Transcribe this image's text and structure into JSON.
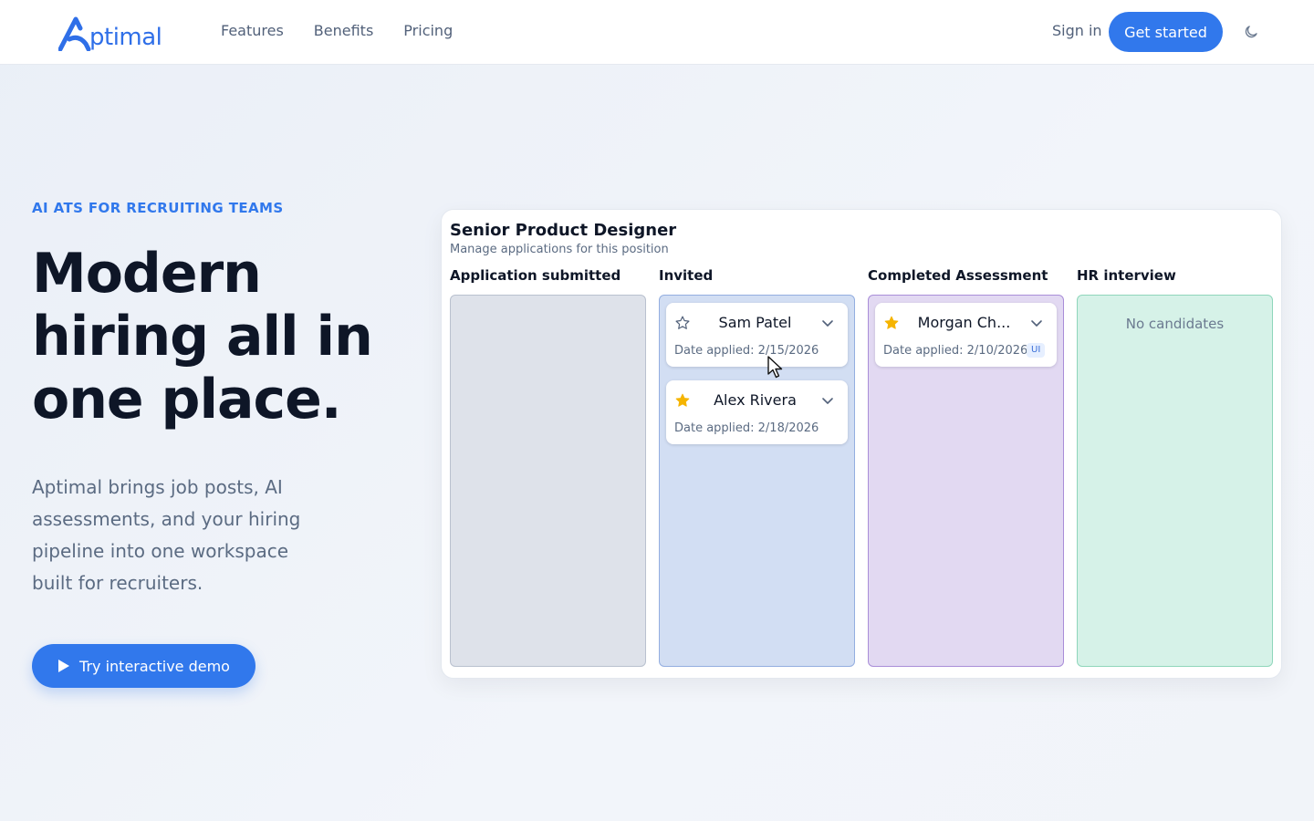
{
  "nav": {
    "logo_text": "ptimal",
    "links": [
      "Features",
      "Benefits",
      "Pricing"
    ],
    "signin": "Sign in",
    "cta": "Get started",
    "theme_icon": "moon-icon"
  },
  "hero": {
    "eyebrow": "AI ATS FOR RECRUITING TEAMS",
    "headline": "Modern hiring all in one place.",
    "lede": "Aptimal brings job posts, AI assessments, and your hiring pipeline into one workspace built for recruiters.",
    "demo_button": "Try interactive demo"
  },
  "board": {
    "title": "Senior Product Designer",
    "subtitle": "Manage applications for this position",
    "columns": [
      {
        "label": "Application submitted",
        "empty_text": ""
      },
      {
        "label": "Invited",
        "empty_text": ""
      },
      {
        "label": "Completed Assessment",
        "empty_text": ""
      },
      {
        "label": "HR interview",
        "empty_text": "No candidates"
      }
    ],
    "cards": [
      {
        "name": "Sam Patel",
        "date": "Date applied: 2/15/2026",
        "starred": false,
        "tag": ""
      },
      {
        "name": "Alex Rivera",
        "date": "Date applied: 2/18/2026",
        "starred": true,
        "tag": ""
      },
      {
        "name": "Morgan Ch...",
        "date": "Date applied: 2/10/2026",
        "starred": true,
        "tag": "UI"
      }
    ]
  },
  "colors": {
    "accent": "#3178ec",
    "star_filled": "#f5b400"
  }
}
